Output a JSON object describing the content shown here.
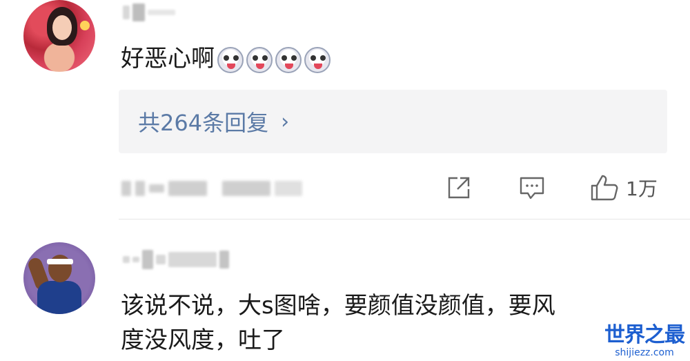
{
  "comments": [
    {
      "text": "好恶心啊",
      "emoji_count": 4,
      "emoji_icon": "grimace-emoji-icon"
    },
    {
      "text_line1": "该说不说，大s图啥，要颜值没颜值，要风",
      "text_line2": "度没风度，吐了"
    }
  ],
  "replies": {
    "label": "共264条回复",
    "chevron": "›"
  },
  "actions": {
    "share_icon": "share-icon",
    "comment_icon": "comment-icon",
    "like_icon": "thumbs-up-icon",
    "like_count": "1万"
  },
  "watermark": {
    "title": "世界之最",
    "url": "shijiezz.com"
  },
  "colors": {
    "link": "#5b7aa6",
    "watermark": "#1d5fd0"
  }
}
